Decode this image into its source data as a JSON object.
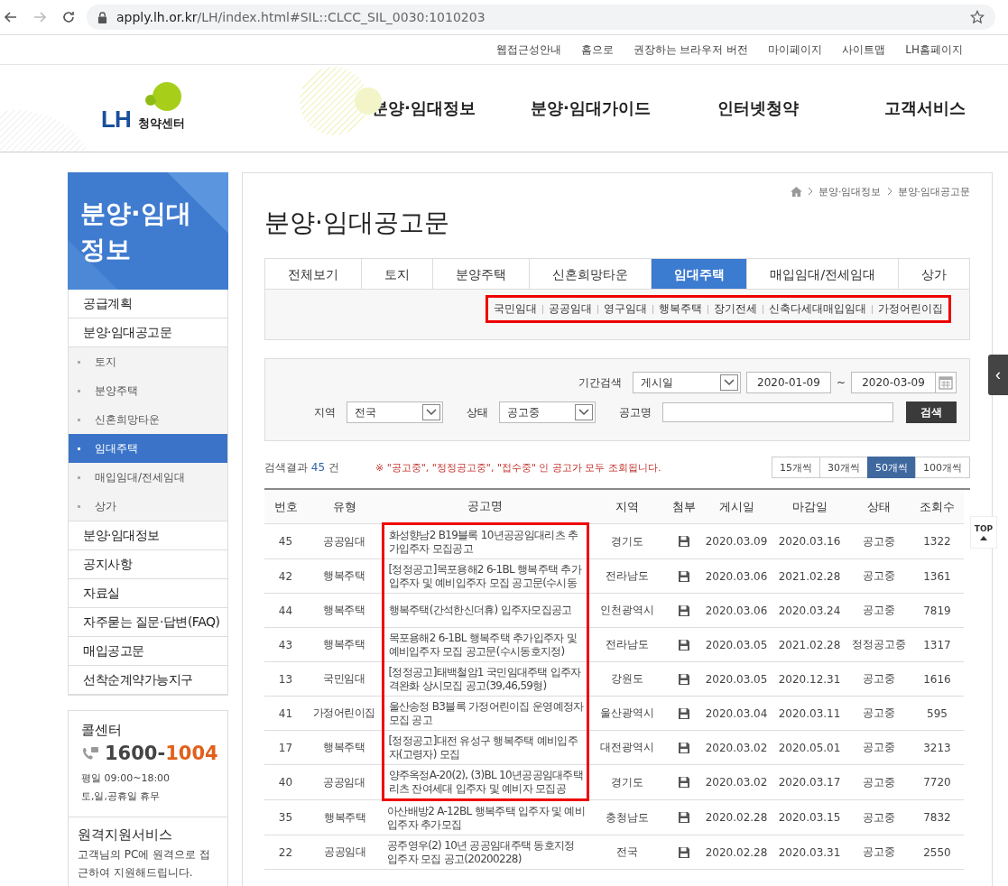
{
  "browser": {
    "url_host": "apply.lh.or.kr",
    "url_path": "/LH/index.html#SIL::CLCC_SIL_0030:1010203"
  },
  "util_links": [
    "웹접근성안내",
    "홈으로",
    "권장하는 브라우저 버전",
    "마이페이지",
    "사이트맵",
    "LH홈페이지"
  ],
  "logo": {
    "mark": "LH",
    "subtitle": "청약센터"
  },
  "nav": [
    "분양·임대정보",
    "분양·임대가이드",
    "인터넷청약",
    "고객서비스"
  ],
  "sidebar": {
    "title_lines": [
      "분양·임대",
      "정보"
    ],
    "items": [
      {
        "label": "공급계획"
      },
      {
        "label": "분양·임대공고문",
        "children": [
          {
            "label": "토지",
            "selected": false
          },
          {
            "label": "분양주택",
            "selected": false
          },
          {
            "label": "신혼희망타운",
            "selected": false
          },
          {
            "label": "임대주택",
            "selected": true
          },
          {
            "label": "매입임대/전세임대",
            "selected": false
          },
          {
            "label": "상가",
            "selected": false
          }
        ]
      },
      {
        "label": "분양·임대정보"
      },
      {
        "label": "공지사항"
      },
      {
        "label": "자료실"
      },
      {
        "label": "자주묻는 질문·답변(FAQ)"
      },
      {
        "label": "매입공고문"
      },
      {
        "label": "선착순계약가능지구"
      }
    ],
    "call_center": {
      "title": "콜센터",
      "number_prefix": "1600-",
      "number_suffix": "1004",
      "hours": [
        "평일 09:00~18:00",
        "토,일,공휴일 휴무"
      ]
    },
    "remote": {
      "title": "원격지원서비스",
      "text": "고객님의 PC에 원격으로 접근하여 지원해드립니다."
    }
  },
  "breadcrumb": [
    "분양·임대정보",
    "분양·임대공고문"
  ],
  "page_title": "분양·임대공고문",
  "tabs": [
    {
      "label": "전체보기",
      "selected": false
    },
    {
      "label": "토지",
      "selected": false
    },
    {
      "label": "분양주택",
      "selected": false
    },
    {
      "label": "신혼희망타운",
      "selected": false
    },
    {
      "label": "임대주택",
      "selected": true
    },
    {
      "label": "매입임대/전세임대",
      "selected": false
    },
    {
      "label": "상가",
      "selected": false
    }
  ],
  "sub_tabs": {
    "highlighted": true,
    "items": [
      "국민임대",
      "공공임대",
      "영구임대",
      "행복주택",
      "장기전세",
      "신축다세대매입임대",
      "가정어린이집"
    ]
  },
  "filter": {
    "period_label": "기간검색",
    "period_type": "게시일",
    "date_from": "2020-01-09",
    "date_sep": "~",
    "date_to": "2020-03-09",
    "region_label": "지역",
    "region": "전국",
    "status_label": "상태",
    "status": "공고중",
    "name_label": "공고명",
    "search_button": "검색"
  },
  "results": {
    "label": "검색결과",
    "count": "45",
    "unit": "건",
    "notice": "※ \"공고중\", \"정정공고중\", \"접수중\" 인 공고가 모두 조회됩니다.",
    "page_sizes": [
      {
        "label": "15개씩",
        "selected": false
      },
      {
        "label": "30개씩",
        "selected": false
      },
      {
        "label": "50개씩",
        "selected": true
      },
      {
        "label": "100개씩",
        "selected": false
      }
    ]
  },
  "table": {
    "columns": [
      "번호",
      "유형",
      "공고명",
      "지역",
      "첨부",
      "게시일",
      "마감일",
      "상태",
      "조회수"
    ],
    "rows": [
      {
        "no": "45",
        "type": "공공임대",
        "title": "화성향남2 B19블록 10년공공임대리츠 추가입주자 모집공고",
        "region": "경기도",
        "attachment": true,
        "posted": "2020.03.09",
        "deadline": "2020.03.16",
        "status": "공고중",
        "views": "1322",
        "highlighted": true
      },
      {
        "no": "42",
        "type": "행복주택",
        "title": "[정정공고]목포용해2 6-1BL 행복주택 추가입주자 및 예비입주자 모집 공고문(수시동",
        "region": "전라남도",
        "attachment": true,
        "posted": "2020.03.06",
        "deadline": "2021.02.28",
        "status": "공고중",
        "views": "1361",
        "highlighted": true
      },
      {
        "no": "44",
        "type": "행복주택",
        "title": "행복주택(간석한신더휴) 입주자모집공고",
        "region": "인천광역시",
        "attachment": true,
        "posted": "2020.03.06",
        "deadline": "2020.03.24",
        "status": "공고중",
        "views": "7819",
        "highlighted": true
      },
      {
        "no": "43",
        "type": "행복주택",
        "title": "목포용해2 6-1BL 행복주택 추가입주자 및 예비입주자 모집 공고문(수시동호지정)",
        "region": "전라남도",
        "attachment": true,
        "posted": "2020.03.05",
        "deadline": "2021.02.28",
        "status": "정정공고중",
        "views": "1317",
        "highlighted": true
      },
      {
        "no": "13",
        "type": "국민임대",
        "title": "[정정공고]태백철암1 국민임대주택 입주자격완화 상시모집 공고(39,46,59형)",
        "region": "강원도",
        "attachment": true,
        "posted": "2020.03.05",
        "deadline": "2020.12.31",
        "status": "공고중",
        "views": "1616",
        "highlighted": true
      },
      {
        "no": "41",
        "type": "가정어린이집",
        "title": "울산송정 B3블록 가정어린이집 운영예정자 모집 공고",
        "region": "울산광역시",
        "attachment": true,
        "posted": "2020.03.04",
        "deadline": "2020.03.11",
        "status": "공고중",
        "views": "595",
        "highlighted": true
      },
      {
        "no": "17",
        "type": "행복주택",
        "title": "[정정공고]대전 유성구 행복주택 예비입주자(고령자) 모집",
        "region": "대전광역시",
        "attachment": true,
        "posted": "2020.03.02",
        "deadline": "2020.05.01",
        "status": "공고중",
        "views": "3213",
        "highlighted": true
      },
      {
        "no": "40",
        "type": "공공임대",
        "title": "양주옥정A-20(2), (3)BL 10년공공임대주택리츠 잔여세대 입주자 및 예비자 모집공",
        "region": "경기도",
        "attachment": true,
        "posted": "2020.03.02",
        "deadline": "2020.03.17",
        "status": "공고중",
        "views": "7720",
        "highlighted": true
      },
      {
        "no": "35",
        "type": "행복주택",
        "title": "아산배방2  A-12BL 행복주택 입주자 및 예비입주자 추가모집",
        "region": "충청남도",
        "attachment": true,
        "posted": "2020.02.28",
        "deadline": "2020.03.15",
        "status": "공고중",
        "views": "7832",
        "highlighted": false
      },
      {
        "no": "22",
        "type": "공공임대",
        "title": "공주영우(2) 10년 공공임대주택 동호지정 입주자 모집 공고(20200228)",
        "region": "전국",
        "attachment": true,
        "posted": "2020.02.28",
        "deadline": "2020.03.31",
        "status": "공고중",
        "views": "2550",
        "highlighted": false
      }
    ]
  },
  "side_controls": {
    "collapse_glyph": "‹",
    "top_label": "TOP"
  }
}
